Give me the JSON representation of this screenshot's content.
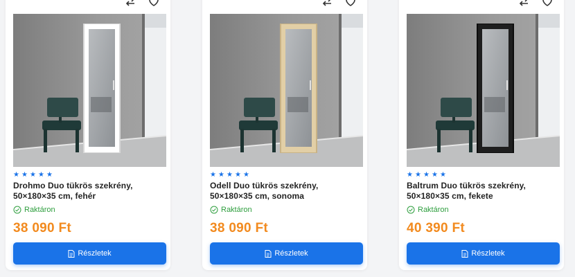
{
  "products": [
    {
      "rating_stars": 5,
      "title": "Drohmo Duo tükrös szekrény, 50×180×35 cm, fehér",
      "stock": "Raktáron",
      "price": "38 090 Ft",
      "button_label": "Részletek",
      "frame_color": "#ffffff",
      "frame_edge": "#d8d8d8"
    },
    {
      "rating_stars": 5,
      "title": "Odell Duo tükrös szekrény, 50×180×35 cm, sonoma",
      "stock": "Raktáron",
      "price": "38 090 Ft",
      "button_label": "Részletek",
      "frame_color": "#e2cfa6",
      "frame_edge": "#c9b386"
    },
    {
      "rating_stars": 5,
      "title": "Baltrum Duo tükrös szekrény, 50×180×35 cm, fekete",
      "stock": "Raktáron",
      "price": "40 390 Ft",
      "button_label": "Részletek",
      "frame_color": "#1e1e1e",
      "frame_edge": "#0c0c0c"
    }
  ],
  "colors": {
    "accent": "#1a73e8",
    "price": "#f28a1e",
    "stock": "#2e9e3e"
  },
  "icons": {
    "compare": "compare-arrows-icon",
    "wishlist": "heart-icon",
    "stock": "check-circle-icon",
    "button": "document-icon",
    "rating": "star-icon"
  }
}
